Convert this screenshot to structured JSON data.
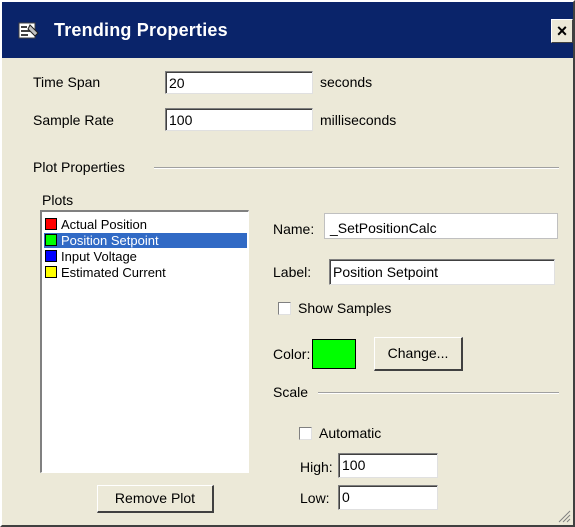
{
  "window": {
    "title": "Trending Properties",
    "close_glyph": "×",
    "title_icon": "properties-icon"
  },
  "time_span": {
    "label": "Time Span",
    "value": "20",
    "unit": "seconds"
  },
  "sample_rate": {
    "label": "Sample Rate",
    "value": "100",
    "unit": "milliseconds"
  },
  "plot_properties": {
    "group_label": "Plot Properties",
    "plots_label": "Plots",
    "plots": [
      {
        "label": "Actual Position",
        "color": "#ff0000",
        "selected": false
      },
      {
        "label": "Position Setpoint",
        "color": "#00ff00",
        "selected": true
      },
      {
        "label": "Input Voltage",
        "color": "#0000ff",
        "selected": false
      },
      {
        "label": "Estimated Current",
        "color": "#ffff00",
        "selected": false
      }
    ],
    "remove_button": "Remove Plot"
  },
  "details": {
    "name_label": "Name:",
    "name_value": "_SetPositionCalc",
    "label_label": "Label:",
    "label_value": "Position Setpoint",
    "show_samples_label": "Show Samples",
    "show_samples_checked": false,
    "color_label": "Color:",
    "color_value": "#00ff00",
    "change_button": "Change..."
  },
  "scale": {
    "group_label": "Scale",
    "automatic_label": "Automatic",
    "automatic_checked": false,
    "high_label": "High:",
    "high_value": "100",
    "low_label": "Low:",
    "low_value": "0"
  }
}
